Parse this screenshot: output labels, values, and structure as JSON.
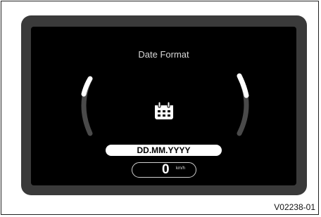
{
  "screen": {
    "title": "Date Format",
    "icon": "calendar-icon",
    "selected_value": "DD.MM.YYYY"
  },
  "speed": {
    "value": "0",
    "unit": "km/h"
  },
  "figure_code": "V02238-01",
  "colors": {
    "cluster_bezel": "#3a3a3a",
    "screen_bg": "#000000",
    "text": "#ffffff",
    "gauge_track": "#4a4a4a",
    "gauge_active": "#ffffff"
  }
}
